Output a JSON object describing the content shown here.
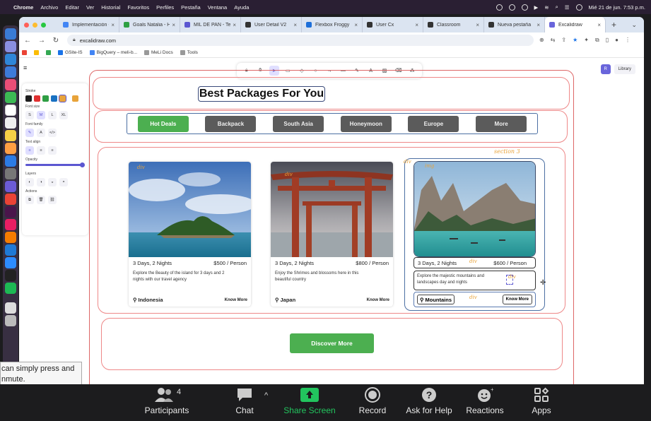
{
  "menubar": {
    "app": "Chrome",
    "items": [
      "Archivo",
      "Editar",
      "Ver",
      "Historial",
      "Favoritos",
      "Perfiles",
      "Pestaña",
      "Ventana",
      "Ayuda"
    ],
    "datetime": "Mié 21 de jun.  7:53 p.m."
  },
  "tabs": [
    {
      "label": "Implementación - H",
      "color": "#4285f4",
      "active": false
    },
    {
      "label": "Goals Natalia - H",
      "color": "#2ea043",
      "active": false
    },
    {
      "label": "MIL DE PAN - Tel",
      "color": "#5b57d1",
      "active": false
    },
    {
      "label": "User Detail V2",
      "color": "#333333",
      "active": false
    },
    {
      "label": "Flexbox Froggy",
      "color": "#1e6fd9",
      "active": false
    },
    {
      "label": "User Cx",
      "color": "#333333",
      "active": false
    },
    {
      "label": "Classroom",
      "color": "#333333",
      "active": false
    },
    {
      "label": "Nueva pestaña",
      "color": "#333333",
      "active": false
    },
    {
      "label": "Excalidraw",
      "color": "#6965db",
      "active": true
    }
  ],
  "address": {
    "url": "excalidraw.com"
  },
  "bookmarks": [
    "GSite-IS",
    "BigQuery – meli-b...",
    "MeLi Docs",
    "Tools"
  ],
  "panel": {
    "stroke_label": "Stroke",
    "stroke_colors": [
      "#1e1e1e",
      "#e03131",
      "#2f9e44",
      "#1971c2",
      "#e8a33a"
    ],
    "font_size_label": "Font size",
    "font_sizes": [
      "S",
      "M",
      "L",
      "XL"
    ],
    "font_family_label": "Font family",
    "text_align_label": "Text align",
    "opacity_label": "Opacity",
    "layers_label": "Layers",
    "actions_label": "Actions"
  },
  "library": {
    "label": "Library",
    "avatar": "R"
  },
  "design": {
    "title": "Best Packages For You",
    "nav": [
      "Hot Deals",
      "Backpack",
      "South Asia",
      "Honeymoon",
      "Europe",
      "More"
    ],
    "cards": [
      {
        "duration": "3 Days, 2 Nights",
        "price": "$500 / Person",
        "desc": "Explore the Beauty of the island for 3 days and 2 nights with our travel agency",
        "location": "Indonesia",
        "cta": "Know More",
        "tag": "div"
      },
      {
        "duration": "3 Days, 2 Nights",
        "price": "$800 / Person",
        "desc": "Enjoy the Shrimes and blossoms here in this beautiful country",
        "location": "Japan",
        "cta": "Know More",
        "tag": "div"
      },
      {
        "duration": "3 Days, 2 Nights",
        "price": "$600 / Person",
        "desc": "Explore the majestic mountains and landscapes day and nights",
        "location": "Mountains",
        "cta": "Know More",
        "tag": "div",
        "img_tag": "img",
        "div2": "div",
        "div3": "div",
        "div4": "div"
      }
    ],
    "section_label": "section 3",
    "discover": "Discover More"
  },
  "zoom": {
    "participants_label": "Participants",
    "participants_count": "4",
    "chat": "Chat",
    "share": "Share Screen",
    "record": "Record",
    "help": "Ask for Help",
    "reactions": "Reactions",
    "apps": "Apps"
  },
  "tooltip": {
    "line1": "can simply press and",
    "line2": "nmute."
  }
}
